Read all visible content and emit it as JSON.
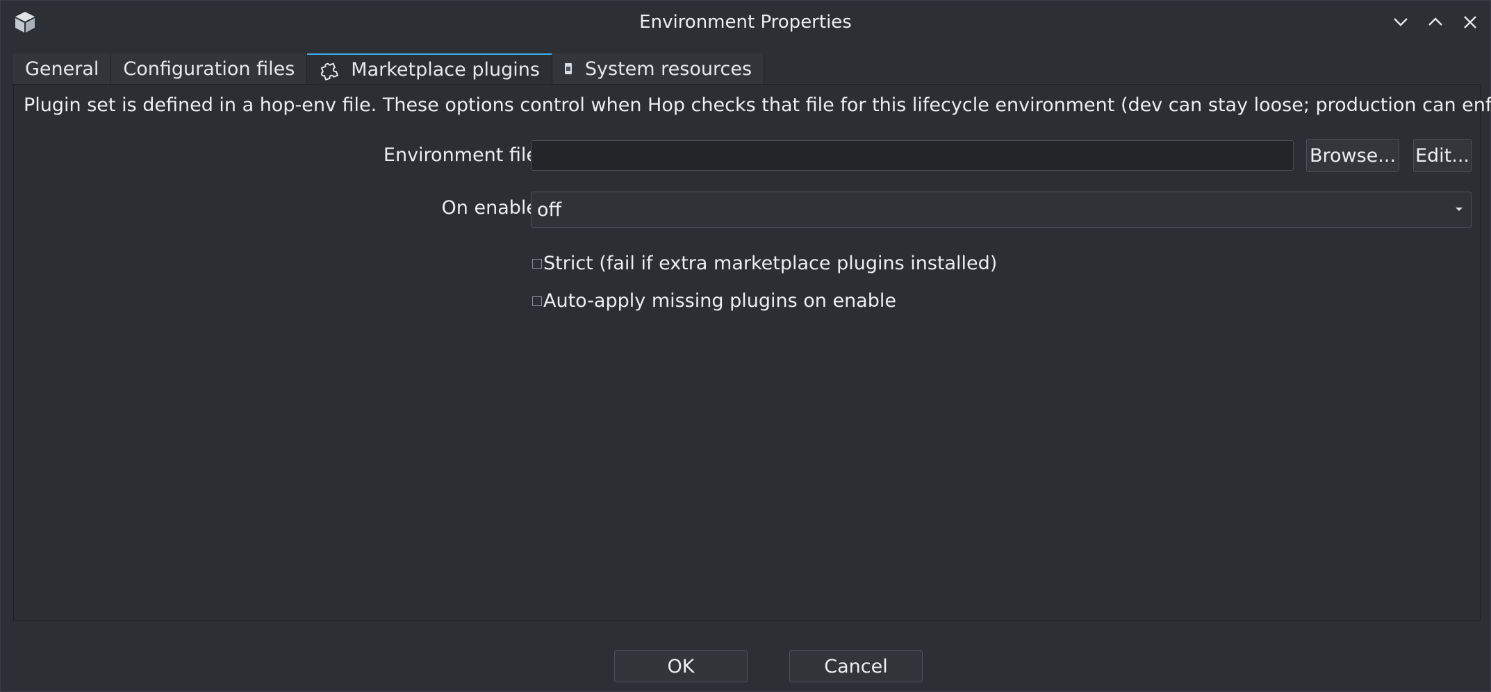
{
  "window": {
    "title": "Environment Properties",
    "app_icon": "cube-icon",
    "controls": [
      "minimize-icon",
      "maximize-icon",
      "close-icon"
    ]
  },
  "tabs": [
    {
      "label": "General",
      "icon": null,
      "active": false
    },
    {
      "label": "Configuration files",
      "icon": null,
      "active": false
    },
    {
      "label": "Marketplace plugins",
      "icon": "puzzle-icon",
      "active": true
    },
    {
      "label": "System resources",
      "icon": "memory-icon",
      "active": false
    }
  ],
  "panel": {
    "description": "Plugin set is defined in a hop-env file. These options control when Hop checks that file for this lifecycle environment (dev can stay loose; production can enforce).",
    "environment_file": {
      "label": "Environment file",
      "value": "",
      "browse_label": "Browse...",
      "edit_label": "Edit..."
    },
    "on_enable": {
      "label": "On enable",
      "value": "off"
    },
    "strict": {
      "label": "Strict (fail if extra marketplace plugins installed)",
      "checked": false
    },
    "auto_apply": {
      "label": "Auto-apply missing plugins on enable",
      "checked": false
    }
  },
  "footer": {
    "ok_label": "OK",
    "cancel_label": "Cancel"
  },
  "colors": {
    "background": "#2c2f34",
    "panel": "#2b2e33",
    "accent": "#3daee9",
    "text": "#eceef0"
  }
}
